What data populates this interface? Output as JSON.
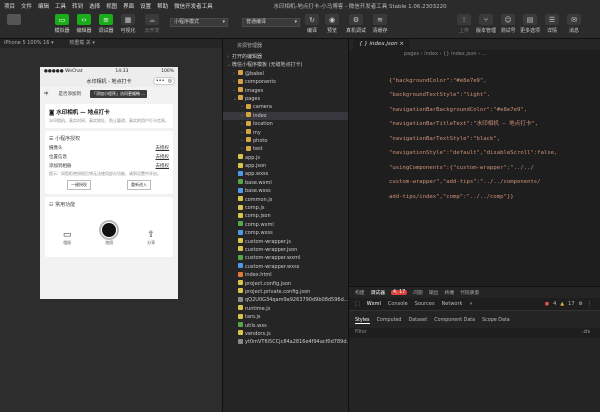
{
  "menu": {
    "items": [
      "项目",
      "文件",
      "编辑",
      "工具",
      "转到",
      "选择",
      "视图",
      "界面",
      "设置",
      "帮助",
      "微信开发者工具"
    ],
    "title": "水印相机-地点打卡-小马博客 - 微信开发者工具 Stable 1.06.2303220"
  },
  "toolbar": {
    "buttons": [
      {
        "label": "模拟器"
      },
      {
        "label": "编辑器"
      },
      {
        "label": "调试器"
      },
      {
        "label": "可视化"
      },
      {
        "label": "云开发"
      }
    ],
    "mode_select": "小程序模式",
    "compile_select": "普通编译",
    "right_buttons": [
      {
        "label": "上传"
      },
      {
        "label": "版本管理"
      },
      {
        "label": "测试号"
      },
      {
        "label": "详情"
      },
      {
        "label": "消息"
      }
    ],
    "mid_buttons": [
      {
        "label": "编译"
      },
      {
        "label": "预览"
      },
      {
        "label": "真机调试"
      },
      {
        "label": "清缓存"
      }
    ],
    "extra_right": "更多选项"
  },
  "simulator": {
    "device": "iPhone 5 100% 16 ▾",
    "hot_reload": "热重载 关 ▾",
    "status_time": "14:33",
    "status_carrier": "●●●●● WeChat",
    "status_battery": "100%",
    "nav_title": "水印相机 - 地点打卡",
    "tip_text": "中",
    "tip_text2": "是否添加到",
    "tip_popup": "「添加小程序」访问更顺畅 ...",
    "main_card": {
      "title": "水印相机 — 地点打卡",
      "desc": "水印相机，真实时间、真实地址、防止篡改、真实的用户打卡信息。"
    },
    "auth": {
      "title": "小程序授权",
      "rows": [
        {
          "name": "摄像头",
          "action": "去授权"
        },
        {
          "name": "位置信息",
          "action": "去授权"
        },
        {
          "name": "添加到相册",
          "action": "去授权"
        }
      ],
      "note": "提示：如您拒绝授权后将无法使用部分功能，请到设置中开启。",
      "btn_one": "一键授权",
      "btn_two": "重新进入"
    },
    "common": {
      "title": "常用功能",
      "items": [
        {
          "label": "相册"
        },
        {
          "label": "拍照"
        },
        {
          "label": "分享"
        }
      ]
    }
  },
  "explorer": {
    "header": "资源管理器",
    "open_editors": "打开的编辑器",
    "project": "微信小程序模板 (无缝地点打卡)",
    "tree": [
      {
        "name": "@babel",
        "type": "folder",
        "depth": 1,
        "chev": "›"
      },
      {
        "name": "components",
        "type": "folder",
        "depth": 1,
        "chev": "›"
      },
      {
        "name": "images",
        "type": "folder",
        "depth": 1,
        "chev": "›"
      },
      {
        "name": "pages",
        "type": "folder",
        "depth": 1,
        "chev": "⌄"
      },
      {
        "name": "camera",
        "type": "folder",
        "depth": 2,
        "chev": "›"
      },
      {
        "name": "index",
        "type": "folder",
        "depth": 2,
        "chev": "›"
      },
      {
        "name": "location",
        "type": "folder",
        "depth": 2,
        "chev": "›"
      },
      {
        "name": "my",
        "type": "folder",
        "depth": 2,
        "chev": "›"
      },
      {
        "name": "photo",
        "type": "folder",
        "depth": 2,
        "chev": "›"
      },
      {
        "name": "test",
        "type": "folder",
        "depth": 2,
        "chev": "›"
      },
      {
        "name": "app.js",
        "type": "yellow",
        "depth": 1
      },
      {
        "name": "app.json",
        "type": "yellow",
        "depth": 1
      },
      {
        "name": "app.wxss",
        "type": "blue",
        "depth": 1
      },
      {
        "name": "base.wxml",
        "type": "green",
        "depth": 1
      },
      {
        "name": "base.wxss",
        "type": "blue",
        "depth": 1
      },
      {
        "name": "common.js",
        "type": "yellow",
        "depth": 1
      },
      {
        "name": "comp.js",
        "type": "yellow",
        "depth": 1
      },
      {
        "name": "comp.json",
        "type": "yellow",
        "depth": 1
      },
      {
        "name": "comp.wxml",
        "type": "green",
        "depth": 1
      },
      {
        "name": "comp.wxss",
        "type": "blue",
        "depth": 1
      },
      {
        "name": "custom-wrapper.js",
        "type": "yellow",
        "depth": 1
      },
      {
        "name": "custom-wrapper.json",
        "type": "yellow",
        "depth": 1
      },
      {
        "name": "custom-wrapper.wxml",
        "type": "green",
        "depth": 1
      },
      {
        "name": "custom-wrapper.wxss",
        "type": "blue",
        "depth": 1
      },
      {
        "name": "index.html",
        "type": "orange",
        "depth": 1
      },
      {
        "name": "project.config.json",
        "type": "yellow",
        "depth": 1
      },
      {
        "name": "project.private.config.json",
        "type": "yellow",
        "depth": 1
      },
      {
        "name": "qQ2U0G34qam9a9263790d9b08d596d...",
        "type": "grey",
        "depth": 1
      },
      {
        "name": "runtime.js",
        "type": "yellow",
        "depth": 1
      },
      {
        "name": "taro.js",
        "type": "yellow",
        "depth": 1
      },
      {
        "name": "utils.wxs",
        "type": "green",
        "depth": 1
      },
      {
        "name": "vendors.js",
        "type": "yellow",
        "depth": 1
      },
      {
        "name": "yt0mVT6i5CCjc84a2816e4f94acf0d789d...",
        "type": "grey",
        "depth": 1
      }
    ]
  },
  "editor": {
    "tab": "{ } index.json ×",
    "breadcrumb": "pages › index › {} index.json › ...",
    "lines": [
      "{\"backgroundColor\":\"#e8e7e9\",",
      "\"backgroundTextStyle\":\"light\",",
      "\"navigationBarBackgroundColor\":\"#e8e7e9\",",
      "\"navigationBarTitleText\":\"水印相机 — 地点打卡\",",
      "\"navigationBarTextStyle\":\"black\",",
      "\"navigationStyle\":\"default\",\"disableScroll\":false,",
      "\"usingComponents\":{\"custom-wrapper\":\"../../",
      "custom-wrapper\",\"add-tips\":\"../../components/",
      "add-tips/index\",\"comp\":\"../../comp\"}}"
    ]
  },
  "devtools": {
    "tabs": [
      "构建",
      "调试器",
      "4, 17",
      "问题",
      "输出",
      "终端",
      "代码质量"
    ],
    "subtabs": [
      "Wxml",
      "Console",
      "Sources",
      "Network",
      "»"
    ],
    "errors": "4",
    "warnings": "17",
    "panes": [
      "Styles",
      "Computed",
      "Dataset",
      "Component Data",
      "Scope Data"
    ],
    "filter_placeholder": "Filter",
    "cls": ".cls"
  }
}
